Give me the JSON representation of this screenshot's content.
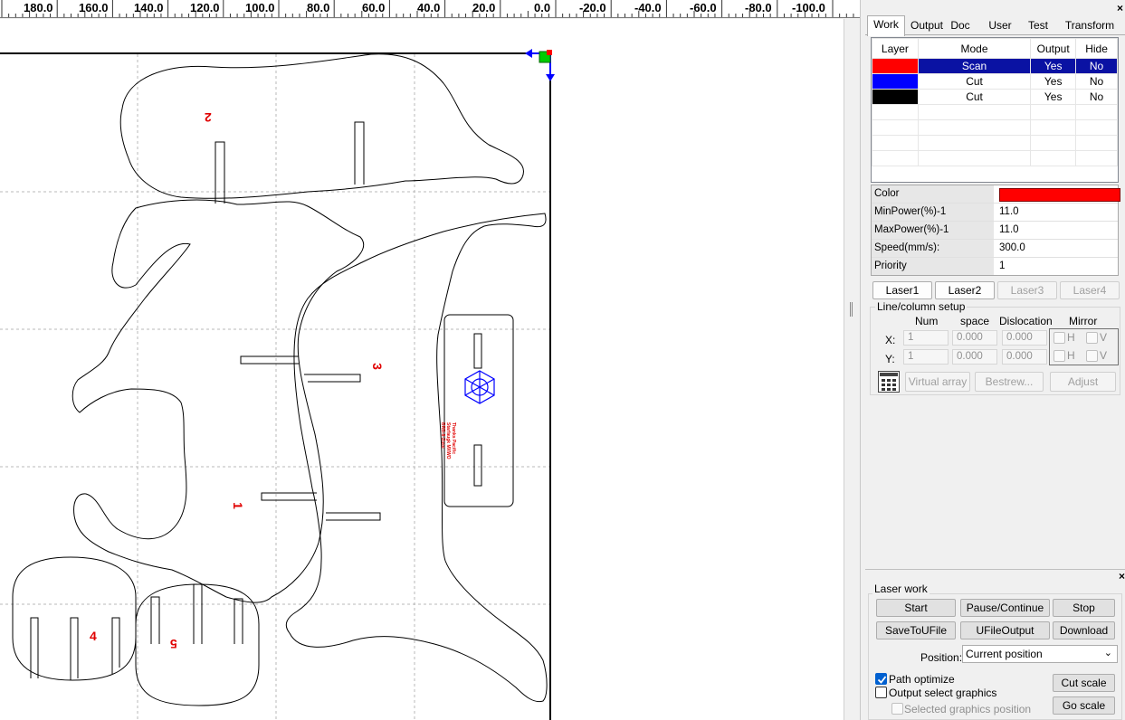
{
  "ruler": {
    "labels": [
      "180.0",
      "160.0",
      "140.0",
      "120.0",
      "100.0",
      "80.0",
      "60.0",
      "40.0",
      "20.0",
      "0.0",
      "-20.0",
      "-40.0",
      "-60.0",
      "-80.0",
      "-100.0"
    ]
  },
  "canvas": {
    "part_labels": [
      "2",
      "3",
      "1",
      "4",
      "5"
    ],
    "logo_text": [
      "Thanks Pacific",
      "Starfaugk MXWO",
      "BRB-8-Zuse"
    ]
  },
  "tabs": [
    {
      "label": "Work",
      "active": true
    },
    {
      "label": "Output"
    },
    {
      "label": "Doc"
    },
    {
      "label": "User"
    },
    {
      "label": "Test"
    },
    {
      "label": "Transform"
    }
  ],
  "layers": {
    "headers": {
      "layer": "Layer",
      "mode": "Mode",
      "output": "Output",
      "hide": "Hide"
    },
    "rows": [
      {
        "color": "#ff0000",
        "mode": "Scan",
        "output": "Yes",
        "hide": "No",
        "selected": true
      },
      {
        "color": "#0000ff",
        "mode": "Cut",
        "output": "Yes",
        "hide": "No"
      },
      {
        "color": "#000000",
        "mode": "Cut",
        "output": "Yes",
        "hide": "No"
      }
    ]
  },
  "props": {
    "color_label": "Color",
    "color_value": "#ff0000",
    "minpower_label": "MinPower(%)-1",
    "minpower": "11.0",
    "maxpower_label": "MaxPower(%)-1",
    "maxpower": "11.0",
    "speed_label": "Speed(mm/s):",
    "speed": "300.0",
    "priority_label": "Priority",
    "priority": "1"
  },
  "laser_tabs": [
    "Laser1",
    "Laser2",
    "Laser3",
    "Laser4"
  ],
  "line_setup": {
    "title": "Line/column setup",
    "num_label": "Num",
    "space_label": "space",
    "dislocation_label": "Dislocation",
    "mirror_label": "Mirror",
    "x_label": "X:",
    "y_label": "Y:",
    "x_num": "1",
    "x_space": "0.000",
    "x_disl": "0.000",
    "y_num": "1",
    "y_space": "0.000",
    "y_disl": "0.000",
    "h_label": "H",
    "v_label": "V",
    "virtual_array": "Virtual array",
    "bestrew": "Bestrew...",
    "adjust": "Adjust"
  },
  "laser_work": {
    "title": "Laser work",
    "start": "Start",
    "pause": "Pause/Continue",
    "stop": "Stop",
    "save": "SaveToUFile",
    "ufile": "UFileOutput",
    "download": "Download",
    "position_label": "Position:",
    "position_value": "Current position",
    "path_optimize": "Path optimize",
    "output_select": "Output select graphics",
    "selected_pos": "Selected graphics position",
    "cut_scale": "Cut scale",
    "go_scale": "Go scale"
  },
  "colors": {
    "selection": "#0a12a3",
    "accent_red": "#ff0000",
    "accent_blue": "#0000ff",
    "checkbox": "#0060d0"
  }
}
